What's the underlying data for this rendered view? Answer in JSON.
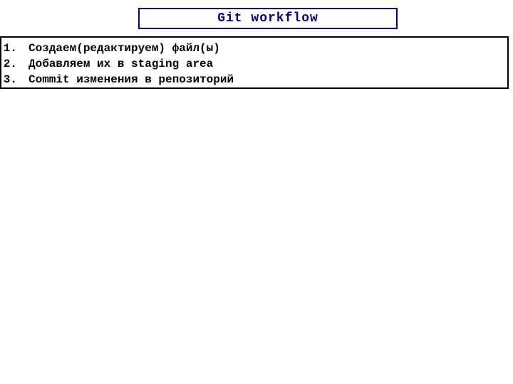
{
  "title": "Git  workflow",
  "steps": [
    "Создаем(редактируем) файл(ы)",
    "Добавляем их в staging area",
    "Commit изменения в репозиторий"
  ]
}
